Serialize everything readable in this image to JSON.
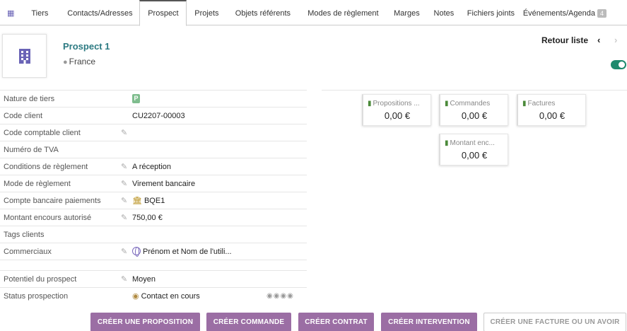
{
  "tabs": [
    {
      "label": "Tiers"
    },
    {
      "label": "Contacts/Adresses"
    },
    {
      "label": "Prospect"
    },
    {
      "label": "Projets"
    },
    {
      "label": "Objets référents"
    },
    {
      "label": "Modes de règlement"
    },
    {
      "label": "Marges"
    },
    {
      "label": "Notes"
    },
    {
      "label": "Fichiers joints"
    },
    {
      "label": "Événements/Agenda",
      "badge": "4"
    }
  ],
  "active_tab": "Prospect",
  "header": {
    "name": "Prospect 1",
    "country": "France",
    "back_label": "Retour liste",
    "prev_icon": "chevron-left-icon",
    "next_icon": "chevron-right-icon",
    "status_toggle": "on"
  },
  "fields": {
    "nature": {
      "label": "Nature de tiers",
      "badge": "P"
    },
    "code_client": {
      "label": "Code client",
      "value": "CU2207-00003"
    },
    "code_compta": {
      "label": "Code comptable client",
      "value": ""
    },
    "tva": {
      "label": "Numéro de TVA",
      "value": ""
    },
    "conditions": {
      "label": "Conditions de règlement",
      "value": "A réception"
    },
    "mode": {
      "label": "Mode de règlement",
      "value": "Virement bancaire"
    },
    "compte": {
      "label": "Compte bancaire paiements",
      "value": "BQE1"
    },
    "encours": {
      "label": "Montant encours autorisé",
      "value": "750,00 €"
    },
    "tags": {
      "label": "Tags clients",
      "value": ""
    },
    "commerciaux": {
      "label": "Commerciaux",
      "value": "Prénom et Nom de l'utili..."
    },
    "potentiel": {
      "label": "Potentiel du prospect",
      "value": "Moyen"
    },
    "status": {
      "label": "Status prospection",
      "value": "Contact en cours"
    }
  },
  "stats": [
    {
      "label": "Propositions ...",
      "value": "0,00 €"
    },
    {
      "label": "Commandes",
      "value": "0,00 €"
    },
    {
      "label": "Factures",
      "value": "0,00 €"
    },
    {
      "label": "Montant enc...",
      "value": "0,00 €"
    }
  ],
  "buttons": {
    "proposition": "CRÉER UNE PROPOSITION",
    "commande": "CRÉER COMMANDE",
    "contrat": "CRÉER CONTRAT",
    "intervention": "CRÉER INTERVENTION",
    "facture": "CRÉER UNE FACTURE OU UN AVOIR"
  },
  "colors": {
    "accent_purple": "#9b6ea4",
    "title_teal": "#2c7a82",
    "toggle_green": "#1e8a6e"
  }
}
